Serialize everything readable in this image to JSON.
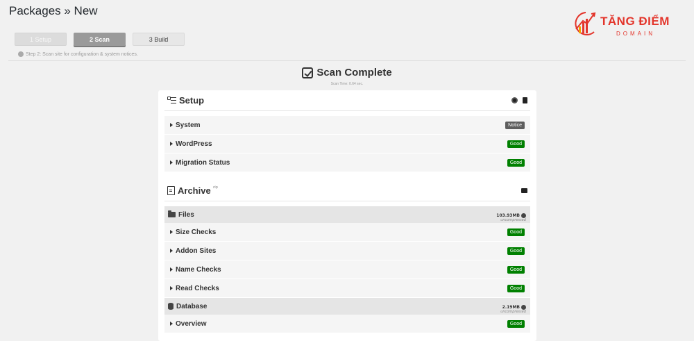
{
  "header": {
    "title": "Packages » New"
  },
  "logo": {
    "main": "TĂNG ĐIỂM",
    "sub": "DOMAIN"
  },
  "steps": [
    {
      "label": "1 Setup"
    },
    {
      "label": "2 Scan"
    },
    {
      "label": "3 Build"
    }
  ],
  "step_hint": "Step 2: Scan site for configuration & system notices.",
  "scan": {
    "title": "Scan Complete",
    "time": "Scan Time: 0.64 sec."
  },
  "setup": {
    "title": "Setup",
    "rows": [
      {
        "label": "System",
        "status": "Notice"
      },
      {
        "label": "WordPress",
        "status": "Good"
      },
      {
        "label": "Migration Status",
        "status": "Good"
      }
    ]
  },
  "archive": {
    "title": "Archive",
    "sup": "zip",
    "files": {
      "title": "Files",
      "size": "103.93MB",
      "size_note": "uncompressed",
      "rows": [
        {
          "label": "Size Checks",
          "status": "Good"
        },
        {
          "label": "Addon Sites",
          "status": "Good"
        },
        {
          "label": "Name Checks",
          "status": "Good"
        },
        {
          "label": "Read Checks",
          "status": "Good"
        }
      ]
    },
    "database": {
      "title": "Database",
      "size": "2.19MB",
      "size_note": "uncompressed",
      "rows": [
        {
          "label": "Overview",
          "status": "Good"
        }
      ]
    }
  },
  "colors": {
    "good": "#008000",
    "notice": "#5e5e5e",
    "logo": "#e3352b"
  }
}
